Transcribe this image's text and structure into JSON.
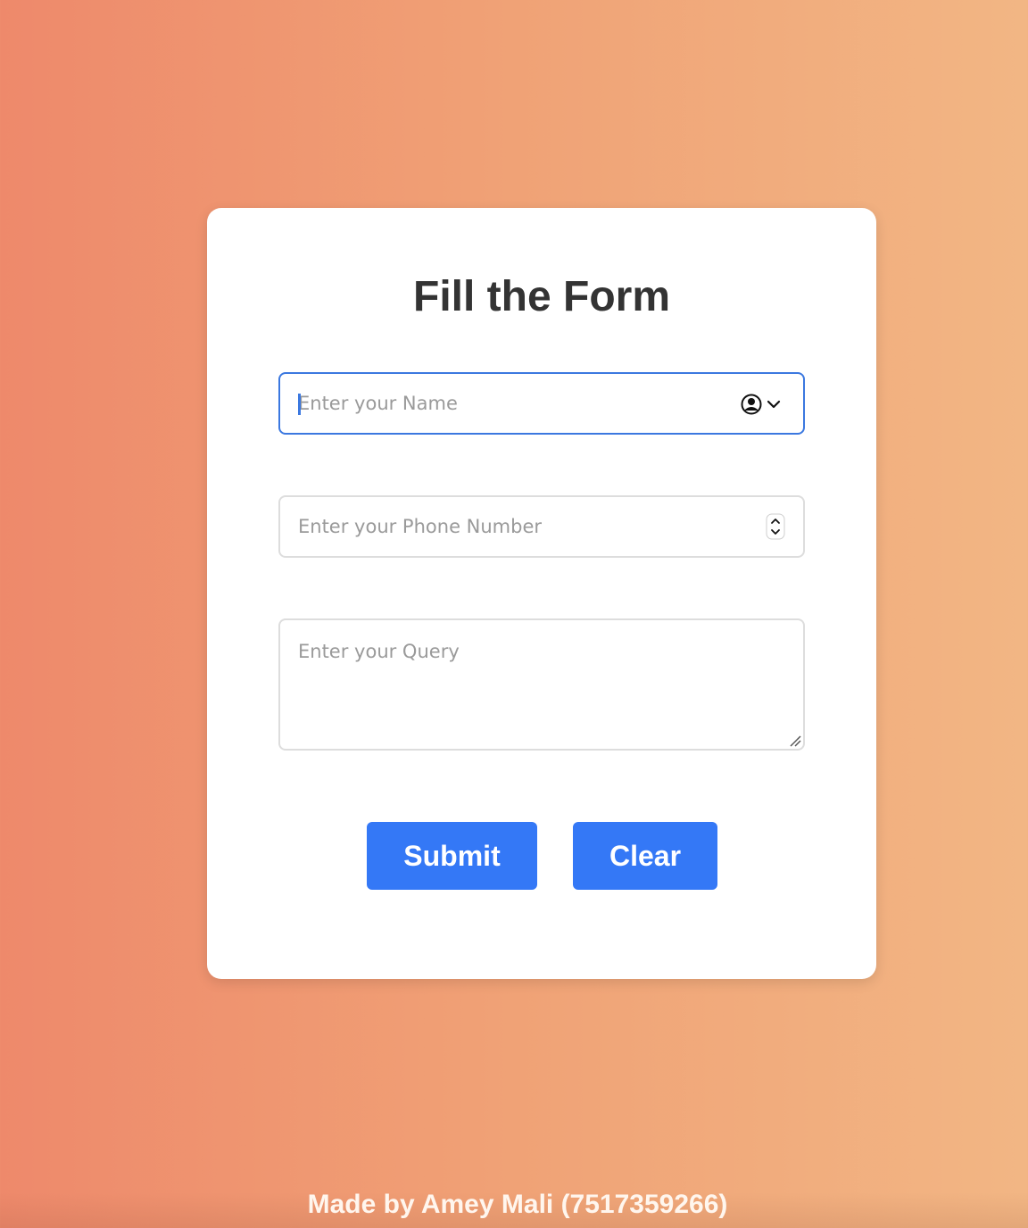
{
  "form": {
    "title": "Fill the Form",
    "name_field": {
      "placeholder": "Enter your Name",
      "value": "",
      "icon": "contact-autofill-icon"
    },
    "phone_field": {
      "placeholder": "Enter your Phone Number",
      "value": "",
      "icon": "number-spinner-icon"
    },
    "query_field": {
      "placeholder": "Enter your Query",
      "value": "",
      "icon": "resize-handle-icon"
    },
    "buttons": {
      "submit_label": "Submit",
      "clear_label": "Clear"
    },
    "accent_color": "#3478f6",
    "focus_color": "#3b78e0"
  },
  "footer": {
    "text": "Made by Amey Mali (7517359266)"
  }
}
